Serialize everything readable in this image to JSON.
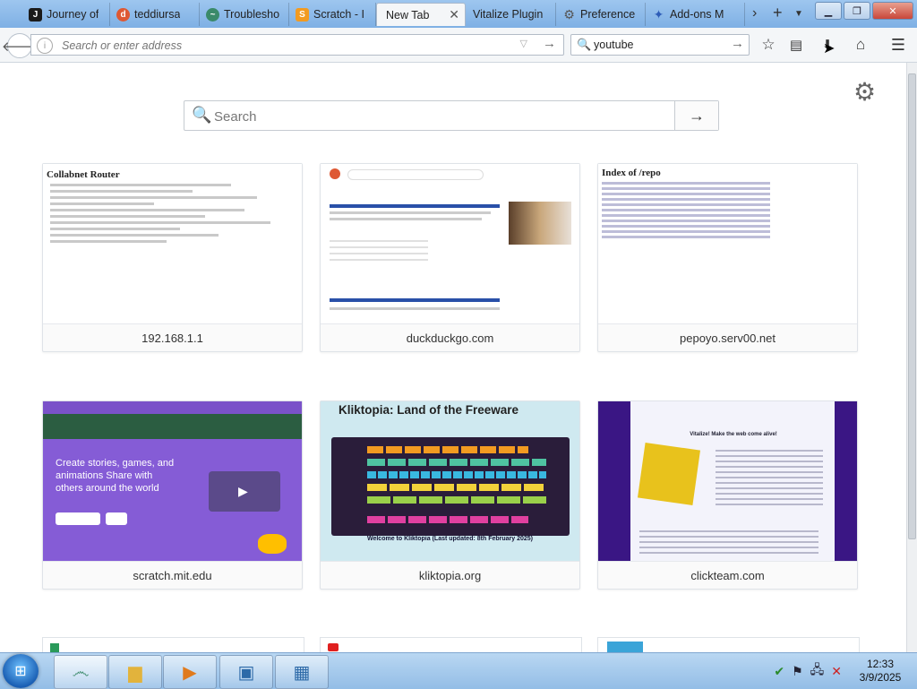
{
  "tabs": [
    {
      "label": "Journey of",
      "icon": "journey-icon",
      "color": "#1b1b1b",
      "active": false
    },
    {
      "label": "teddiursa",
      "icon": "duckduckgo-icon",
      "color": "#de5833",
      "active": false
    },
    {
      "label": "Troublesho",
      "icon": "troubleshoot-icon",
      "color": "#3a8a6a",
      "active": false
    },
    {
      "label": "Scratch - I",
      "icon": "scratch-icon",
      "color": "#f29b21",
      "active": false
    },
    {
      "label": "New Tab",
      "icon": "newtab-icon",
      "color": "#ffffff",
      "active": true
    },
    {
      "label": "Vitalize Plugin",
      "icon": "",
      "color": "#ffffff",
      "active": false
    },
    {
      "label": "Preference",
      "icon": "gear-icon",
      "color": "#666666",
      "active": false
    },
    {
      "label": "Add-ons M",
      "icon": "addons-icon",
      "color": "#2e5db8",
      "active": false
    }
  ],
  "nav": {
    "address_placeholder": "Search or enter address",
    "search_value": "youtube"
  },
  "newtab": {
    "search_placeholder": "Search",
    "tiles": [
      {
        "label": "192.168.1.1",
        "title": "Collabnet Router"
      },
      {
        "label": "duckduckgo.com",
        "title": ""
      },
      {
        "label": "pepoyo.serv00.net",
        "title": "Index of /repo"
      },
      {
        "label": "scratch.mit.edu",
        "title": "Create stories, games, and animations Share with others around the world"
      },
      {
        "label": "kliktopia.org",
        "title": "Kliktopia: Land of the Freeware",
        "subtitle": "Welcome to Kliktopia (Last updated: 8th February 2025)"
      },
      {
        "label": "clickteam.com",
        "title": "Vitalize! Make the web come alive!"
      }
    ]
  },
  "taskbar": {
    "time": "12:33",
    "date": "3/9/2025"
  },
  "colors": {
    "tabstrip": "#8fbbe9",
    "scratch_purple": "#855cd6",
    "clickteam_purple": "#3a1684"
  }
}
